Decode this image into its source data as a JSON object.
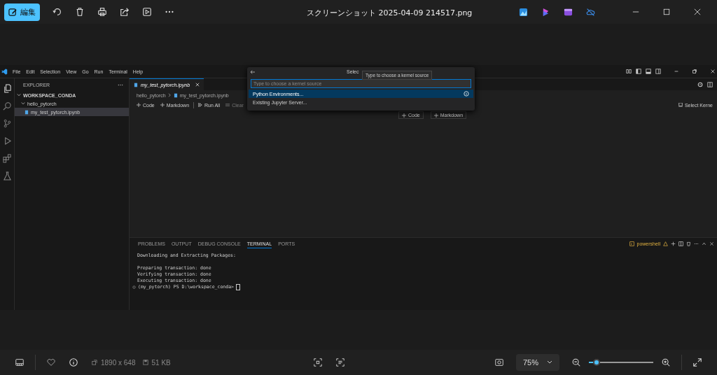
{
  "viewer": {
    "edit_button": "編集",
    "file_title": "スクリーンショット 2025-04-09 214517.png"
  },
  "vscode": {
    "menu": [
      "File",
      "Edit",
      "Selection",
      "View",
      "Go",
      "Run",
      "Terminal",
      "Help"
    ],
    "explorer": {
      "title": "EXPLORER",
      "workspace": "WORKSPACE_CONDA",
      "tree": [
        {
          "label": "hello_pytorch",
          "expanded": true,
          "children": [
            {
              "label": "my_test_pytorch.ipynb",
              "selected": true
            }
          ]
        }
      ]
    },
    "editor_tab": {
      "label": "my_test_pytorch.ipynb"
    },
    "breadcrumbs": [
      "hello_pytorch",
      "my_test_pytorch.ipynb"
    ],
    "notebook_toolbar": [
      {
        "kind": "add",
        "label": "Code"
      },
      {
        "kind": "add",
        "label": "Markdown"
      },
      {
        "kind": "run",
        "label": "Run All"
      },
      {
        "kind": "clear",
        "label": "Clear"
      }
    ],
    "select_kernel": "Select Kerne",
    "add_cell_buttons": [
      "Code",
      "Markdown"
    ],
    "quick_pick": {
      "title": "Selec",
      "placeholder": "Type to choose a kernel source",
      "items": [
        {
          "label": "Python Environments...",
          "selected": true
        },
        {
          "label": "Existing Jupyter Server...",
          "selected": false
        }
      ]
    },
    "tooltip": "Type to choose a kernel source",
    "panel": {
      "tabs": [
        {
          "label": "PROBLEMS",
          "selected": false
        },
        {
          "label": "OUTPUT",
          "selected": false
        },
        {
          "label": "DEBUG CONSOLE",
          "selected": false
        },
        {
          "label": "TERMINAL",
          "selected": true
        },
        {
          "label": "PORTS",
          "selected": false
        }
      ],
      "shell": "powershell",
      "output_blocks": [
        [
          "Downloading and Extracting Packages:"
        ],
        [
          "Preparing transaction: done",
          "Verifying transaction: done",
          "Executing transaction: done"
        ]
      ],
      "prompt": "(my_pytorch) PS D:\\workspace_conda>"
    }
  },
  "status": {
    "dimensions": "1890 x 648",
    "size": "51 KB",
    "zoom": "75%",
    "zoom_slider": {
      "level": 0.12
    }
  }
}
